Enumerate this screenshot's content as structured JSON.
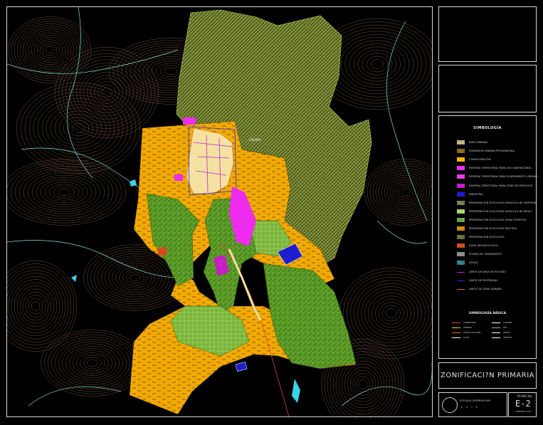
{
  "map": {
    "labels": [
      {
        "text": "COLIBRI"
      }
    ]
  },
  "legend": {
    "title": "SIMBOLOGÍA",
    "items": [
      {
        "label": "ÁREA URBANA",
        "color": "#f5e2a2",
        "pattern": "dots"
      },
      {
        "label": "EXPANSIÓN URBANA PROGRAMADA",
        "color": "#f3a900",
        "pattern": "hatch"
      },
      {
        "label": "CONSOLIDACIÓN",
        "color": "#ffb400",
        "pattern": "solid"
      },
      {
        "label": "RESERVA TERRITORIAL PARA USO HABITACIONAL",
        "color": "#ee2cee",
        "pattern": "solid"
      },
      {
        "label": "RESERVA TERRITORIAL PARA EQUIPAMIENTO URBANO",
        "color": "#e83ce8",
        "pattern": "solid"
      },
      {
        "label": "RESERVA TERRITORIAL PARA ZONA DE SERVICIOS",
        "color": "#c51fc5",
        "pattern": "solid"
      },
      {
        "label": "INDUSTRIA",
        "color": "#1e1ecf",
        "pattern": "solid"
      },
      {
        "label": "PRESERVACIÓN ECOLÓGICA AGRICOLA DE TEMPORAL",
        "color": "#b8d87a",
        "pattern": "hatch"
      },
      {
        "label": "PRESERVACIÓN ECOLÓGICA AGRICOLA DE RIEGO",
        "color": "#9cd04c",
        "pattern": "grid"
      },
      {
        "label": "PRESERVACIÓN ECOLÓGICA ZONA FORESTAL",
        "color": "#4a9a22",
        "pattern": "grid"
      },
      {
        "label": "PRESERVACIÓN ECOLÓGICA PASTIZAL",
        "color": "#ffb400",
        "pattern": "dots"
      },
      {
        "label": "PRESERVACIÓN ECOLÓGICA",
        "color": "#a3b85a",
        "pattern": "hatch"
      },
      {
        "label": "ZONA ARQUEOLÓGICA",
        "color": "#d64a1e",
        "pattern": "solid"
      },
      {
        "label": "PLANTA DE TRATAMIENTO",
        "color": "#8c8c8c",
        "pattern": "solid"
      },
      {
        "label": "AGUAS",
        "color": "#3ad4e8",
        "pattern": "hatch"
      },
      {
        "label": "LIMITE DE AREA DE ESTUDIO",
        "color": "#b52cd4",
        "pattern": "line"
      },
      {
        "label": "LIMITE DE PROPIEDAD",
        "color": "#2a2ad4",
        "pattern": "line"
      },
      {
        "label": "LIMITE DE ZONA URBANA",
        "color": "#e07020",
        "pattern": "line"
      }
    ]
  },
  "basic": {
    "title": "SIMBOLOGÍA BÁSICA",
    "items": [
      {
        "label": "CARRETERA",
        "color": "#e04040"
      },
      {
        "label": "CAMINO",
        "color": "#ffffff"
      },
      {
        "label": "VEREDA",
        "color": "#e0e000"
      },
      {
        "label": "RÍO",
        "color": "#3ad4e8"
      },
      {
        "label": "CURVA DE NIVEL",
        "color": "#e07020"
      },
      {
        "label": "LÍMITE",
        "color": "#ffffff"
      },
      {
        "label": "COTA",
        "color": "#ffffff"
      },
      {
        "label": "VÉRTICE",
        "color": "#ffffff"
      }
    ]
  },
  "title_block": {
    "zoning_title": "ZONIFICACI?N PRIMARIA",
    "school_name": "ESCUELA SUPERIOR IPN",
    "school_sub": "E S I A",
    "plate_label": "PLANO No.",
    "plate_code": "E-2",
    "plate_date": "FEBRERO 2005"
  }
}
